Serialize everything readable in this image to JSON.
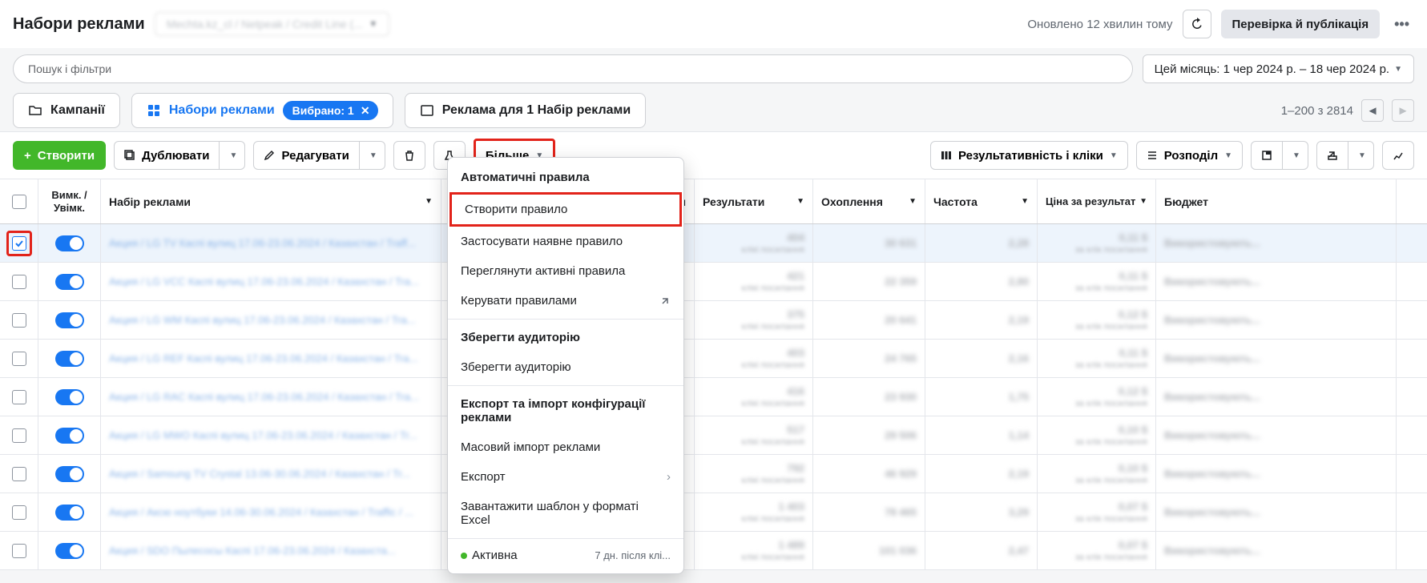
{
  "header": {
    "title": "Набори реклами",
    "account_blurred": "Mechta.kz_cl / Netpeak / Credit Line (...",
    "updated": "Оновлено 12 хвилин тому",
    "review_publish": "Перевірка й публікація"
  },
  "search": {
    "placeholder": "Пошук і фільтри",
    "date_range": "Цей місяць: 1 чер 2024 р. – 18 чер 2024 р."
  },
  "tabs": {
    "campaigns": "Кампанії",
    "adsets": "Набори реклами",
    "selected_label": "Вибрано: 1",
    "ads": "Реклама для 1 Набір реклами"
  },
  "pagination": {
    "text": "1–200 з 2814"
  },
  "toolbar": {
    "create": "Створити",
    "duplicate": "Дублювати",
    "edit": "Редагувати",
    "more": "Більше",
    "perf_clicks": "Результативність і кліки",
    "breakdown": "Розподіл"
  },
  "dropdown": {
    "section1": "Автоматичні правила",
    "items1": [
      "Створити правило",
      "Застосувати наявне правило",
      "Переглянути активні правила",
      "Керувати правилами"
    ],
    "section2": "Зберегти аудиторію",
    "items2": [
      "Зберегти аудиторію"
    ],
    "section3": "Експорт та імпорт конфігурації реклами",
    "items3": [
      "Масовий імпорт реклами",
      "Експорт",
      "Завантажити шаблон у форматі Excel"
    ]
  },
  "table": {
    "headers": {
      "toggle": "Вимк. / Увімк.",
      "name": "Набір реклами",
      "hidden_col": "ня",
      "results": "Результати",
      "reach": "Охоплення",
      "freq": "Частота",
      "cost": "Ціна за результат",
      "budget": "Бюджет"
    },
    "rows": [
      {
        "checked": true,
        "name": "Акция / LG TV Каспі вулиц 17.06-23.06.2024 / Казахстан / Traff...",
        "results": "404",
        "reach": "30 631",
        "freq": "2,28",
        "cost": "0,11 $",
        "budget": "Використовують..."
      },
      {
        "checked": false,
        "name": "Акция / LG VCC Каспі вулиц 17.06-23.06.2024 / Казахстан / Tra...",
        "results": "421",
        "reach": "22 359",
        "freq": "2,80",
        "cost": "0,11 $",
        "budget": "Використовують..."
      },
      {
        "checked": false,
        "name": "Акция / LG WM Каспі вулиц 17.06-23.06.2024 / Казахстан / Tra...",
        "results": "375",
        "reach": "20 641",
        "freq": "2,19",
        "cost": "0,12 $",
        "budget": "Використовують..."
      },
      {
        "checked": false,
        "name": "Акция / LG REF Каспі вулиц 17.06-23.06.2024 / Казахстан / Tra...",
        "results": "403",
        "reach": "24 765",
        "freq": "2,16",
        "cost": "0,11 $",
        "budget": "Використовують..."
      },
      {
        "checked": false,
        "name": "Акция / LG RAC Каспі вулиц 17.06-23.06.2024 / Казахстан / Tra...",
        "results": "416",
        "reach": "23 930",
        "freq": "1,75",
        "cost": "0,12 $",
        "budget": "Використовують..."
      },
      {
        "checked": false,
        "name": "Акция / LG MWO Каспі вулиц 17.06-23.06.2024 / Казахстан / Tr...",
        "results": "517",
        "reach": "29 506",
        "freq": "1,14",
        "cost": "0,10 $",
        "budget": "Використовують..."
      },
      {
        "checked": false,
        "name": "Акция / Samsung TV Crystal 13.06-30.06.2024 / Казахстан / Tr...",
        "results": "792",
        "reach": "46 929",
        "freq": "2,19",
        "cost": "0,10 $",
        "budget": "Використовують..."
      },
      {
        "checked": false,
        "name": "Акция / Aксю ноутбуки 14.06-30.06.2024 / Казахстан / Traffic / ...",
        "results": "1 403",
        "reach": "78 465",
        "freq": "3,29",
        "cost": "0,07 $",
        "budget": "Використовують..."
      },
      {
        "checked": false,
        "name": "Акция / SDO Пылесосы Каспі 17.06-23.06.2024 / Казахста...",
        "results": "1 489",
        "reach": "101 036",
        "freq": "2,47",
        "cost": "0,07 $",
        "budget": "Використовують..."
      }
    ],
    "status_active": "Активна",
    "status_sub": "7 дн. після клі...",
    "sub_label": "клікі посилання",
    "cost_sub": "за клік посилання"
  }
}
